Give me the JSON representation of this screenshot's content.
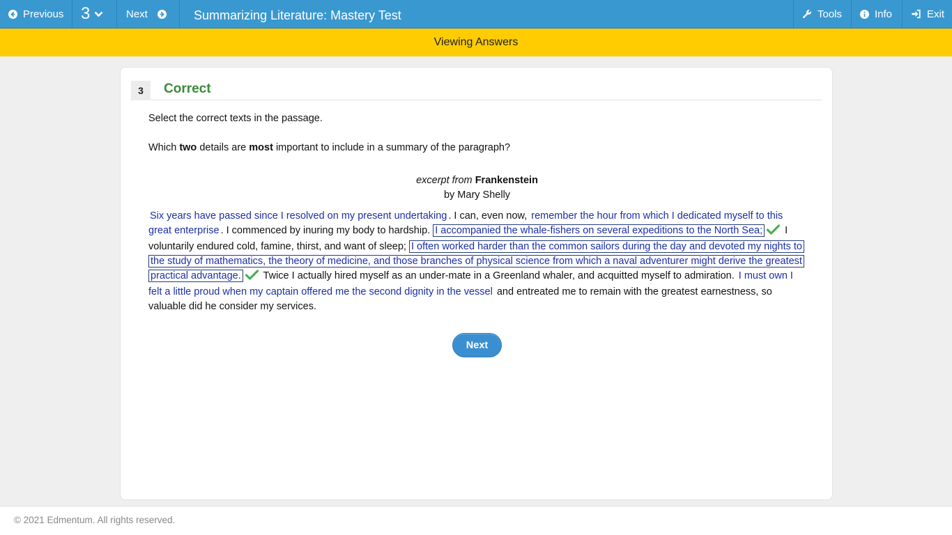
{
  "topbar": {
    "previous_label": "Previous",
    "question_number": "3",
    "next_label": "Next",
    "title": "Summarizing Literature: Mastery Test",
    "tools_label": "Tools",
    "info_label": "Info",
    "exit_label": "Exit",
    "color": "#3a98d0"
  },
  "banner": {
    "text": "Viewing Answers",
    "color": "#fecc00"
  },
  "question": {
    "number": "3",
    "status": "Correct",
    "status_color": "#3d8a3a",
    "instruction": "Select the correct texts in the passage.",
    "prompt_parts": [
      "Which ",
      "two",
      " details are ",
      "most",
      " important to include in a summary of the paragraph?"
    ],
    "source": {
      "prefix": "excerpt from",
      "title": "Frankenstein",
      "author": "by Mary Shelly"
    },
    "passage": [
      {
        "text": "Six years have passed since I resolved on my present undertaking",
        "selectable": true,
        "selected": false
      },
      {
        "text": ". I can, even now, ",
        "selectable": false
      },
      {
        "text": "remember the hour from which I dedicated myself to this great enterprise",
        "selectable": true,
        "selected": false
      },
      {
        "text": ". I commenced by inuring my body to hardship. ",
        "selectable": false
      },
      {
        "text": "I accompanied the whale-fishers on several expeditions to the North Sea;",
        "selectable": true,
        "selected": true,
        "correct": true
      },
      {
        "text": " I voluntarily endured cold, famine, thirst, and want of sleep; ",
        "selectable": false
      },
      {
        "text": "I often worked harder than the common sailors during the day and devoted my nights to the study of mathematics, the theory of medicine, and those branches of physical science from which a naval adventurer might derive the greatest practical advantage.",
        "selectable": true,
        "selected": true,
        "correct": true
      },
      {
        "text": " Twice I actually hired myself as an under-mate in a Greenland whaler, and acquitted myself to admiration. ",
        "selectable": false
      },
      {
        "text": "I must own I felt a little proud when my captain offered me the second dignity in the vessel",
        "selectable": true,
        "selected": false
      },
      {
        "text": " and entreated me to remain with the greatest earnestness, so valuable did he consider my services.",
        "selectable": false
      }
    ],
    "next_button": "Next"
  },
  "footer": {
    "text": "© 2021 Edmentum. All rights reserved."
  }
}
